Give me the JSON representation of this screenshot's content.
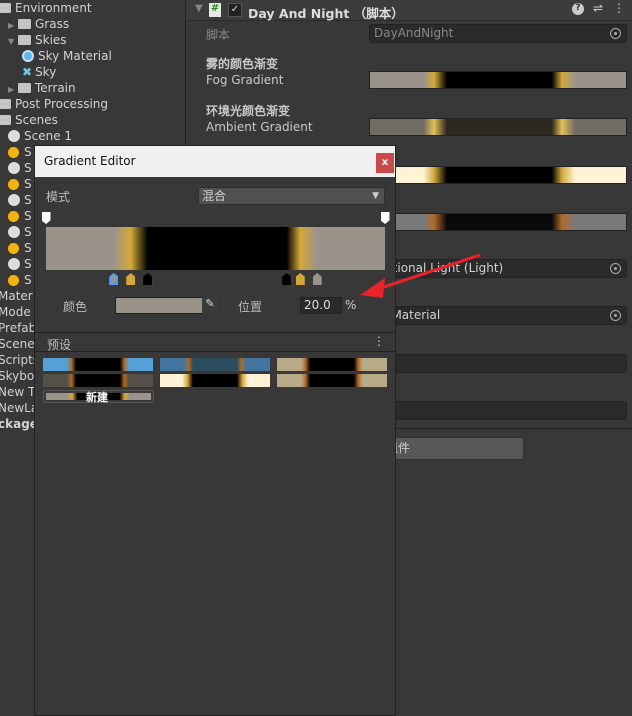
{
  "project_tree": [
    {
      "label": "Environment",
      "icon": "folder-open-icon",
      "indent": 0
    },
    {
      "label": "Grass",
      "icon": "folder-icon",
      "indent": 1,
      "arrow": "right"
    },
    {
      "label": "Skies",
      "icon": "folder-open-icon",
      "indent": 1,
      "arrow": "down"
    },
    {
      "label": "Sky Material",
      "icon": "material-icon",
      "indent": 2
    },
    {
      "label": "Sky",
      "icon": "cubemap-icon",
      "indent": 2
    },
    {
      "label": "Terrain",
      "icon": "folder-icon",
      "indent": 1,
      "arrow": "right"
    },
    {
      "label": "Post Processing",
      "icon": "folder-icon",
      "indent": 0
    },
    {
      "label": "Scenes",
      "icon": "folder-open-icon",
      "indent": 0
    },
    {
      "label": "Scene 1",
      "icon": "unity-scene-icon",
      "indent": 1
    },
    {
      "label": "S",
      "icon": "lighting-icon",
      "indent": 1
    },
    {
      "label": "S",
      "icon": "unity-scene-icon",
      "indent": 1
    },
    {
      "label": "S",
      "icon": "lighting-icon",
      "indent": 1
    },
    {
      "label": "S",
      "icon": "unity-scene-icon",
      "indent": 1
    },
    {
      "label": "S",
      "icon": "lighting-icon",
      "indent": 1
    },
    {
      "label": "S",
      "icon": "unity-scene-icon",
      "indent": 1
    },
    {
      "label": "S",
      "icon": "lighting-icon",
      "indent": 1
    },
    {
      "label": "S",
      "icon": "unity-scene-icon",
      "indent": 1
    },
    {
      "label": "S",
      "icon": "lighting-icon",
      "indent": 1
    },
    {
      "label": "Mater",
      "indent": -1
    },
    {
      "label": "Mode",
      "indent": -1
    },
    {
      "label": "Prefab",
      "indent": -1
    },
    {
      "label": "Scenes",
      "indent": -1
    },
    {
      "label": "Scripts",
      "indent": -1
    },
    {
      "label": "Skybo",
      "indent": -1
    },
    {
      "label": "New T",
      "indent": -1
    },
    {
      "label": "NewLa",
      "indent": -1
    },
    {
      "label": "ckage",
      "indent": -1,
      "bold": true
    }
  ],
  "inspector": {
    "component_title": "Day And Night （脚本）",
    "enabled": true,
    "script_label": "脚本",
    "script_value": "DayAndNight",
    "fog_header": "雾的颜色渐变",
    "fog_label": "Fog Gradient",
    "ambient_header": "环境光颜色渐变",
    "ambient_label": "Ambient Gradient",
    "light_value": "rectional Light (Light)",
    "sky_value": "ky Material",
    "add_component": "加组件"
  },
  "gradient_editor": {
    "title": "Gradient Editor",
    "close": "x",
    "mode_label": "模式",
    "mode_value": "混合",
    "color_label": "颜色",
    "location_label": "位置",
    "location_value": "20.0",
    "location_unit": "%",
    "presets_label": "预设",
    "new_label": "新建",
    "selected_color": "#9a938a",
    "color_stops": [
      {
        "pos": 20,
        "color": "#9a938a",
        "selected": true
      },
      {
        "pos": 25,
        "color": "#d4a838"
      },
      {
        "pos": 30,
        "color": "#000000"
      },
      {
        "pos": 71,
        "color": "#000000"
      },
      {
        "pos": 75,
        "color": "#d4a838"
      },
      {
        "pos": 80,
        "color": "#9a938a"
      }
    ],
    "alpha_stops": [
      0,
      100
    ]
  },
  "colors": {
    "annotation_arrow": "#e8242a",
    "accent": "#4a9eff"
  }
}
